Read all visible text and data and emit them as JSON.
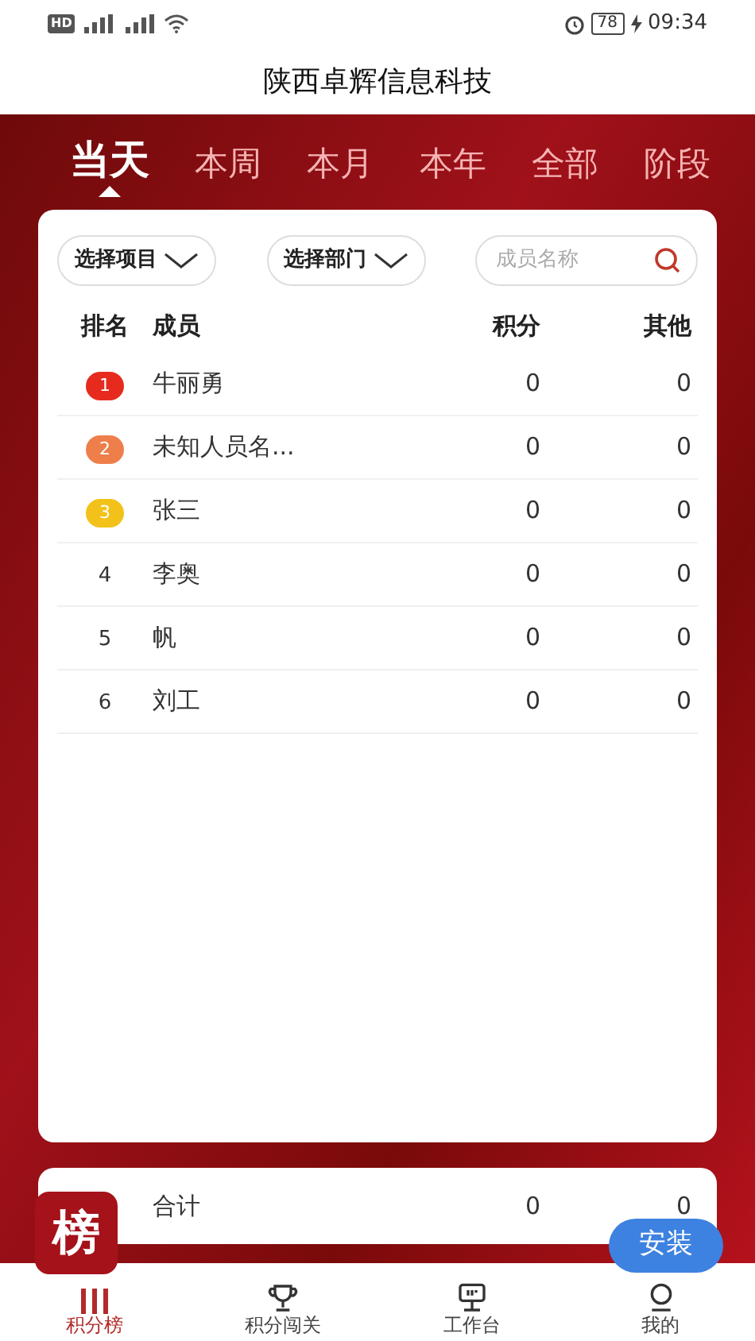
{
  "status_bar": {
    "left": "HD",
    "battery": "78",
    "time": "09:34"
  },
  "title": "陕西卓辉信息科技",
  "tabs": [
    {
      "label": "当天",
      "selected": true
    },
    {
      "label": "本周",
      "selected": false
    },
    {
      "label": "本月",
      "selected": false
    },
    {
      "label": "本年",
      "selected": false
    },
    {
      "label": "全部",
      "selected": false
    },
    {
      "label": "阶段",
      "selected": false
    }
  ],
  "filters": [
    {
      "label": "选择项目"
    },
    {
      "label": "选择部门"
    }
  ],
  "search": {
    "placeholder": "成员名称"
  },
  "table": {
    "columns": [
      "排名",
      "成员",
      "积分",
      "其他"
    ],
    "rows": [
      {
        "rank": "1",
        "kind": "medal",
        "color": "#e62b1e",
        "member": "牛丽勇",
        "points": "0",
        "other": "0"
      },
      {
        "rank": "2",
        "kind": "medal",
        "color": "#ef7f4a",
        "member": "未知人员名...",
        "points": "0",
        "other": "0"
      },
      {
        "rank": "3",
        "kind": "medal",
        "color": "#f3c21a",
        "member": "张三",
        "points": "0",
        "other": "0"
      },
      {
        "rank": "4",
        "kind": "plain",
        "member": "李奥",
        "points": "0",
        "other": "0"
      },
      {
        "rank": "5",
        "kind": "plain",
        "member": "帆",
        "points": "0",
        "other": "0"
      },
      {
        "rank": "6",
        "kind": "plain",
        "member": "刘工",
        "points": "0",
        "other": "0"
      }
    ]
  },
  "total": {
    "label": "合计",
    "points": "0",
    "other": "0"
  },
  "app_badge": {
    "label": "榜"
  },
  "install_button": {
    "label": "安装"
  },
  "bottom_nav": [
    {
      "label": "积分榜",
      "selected": true
    },
    {
      "label": "积分闯关",
      "selected": false
    },
    {
      "label": "工作台",
      "selected": false
    },
    {
      "label": "我的",
      "selected": false
    }
  ]
}
